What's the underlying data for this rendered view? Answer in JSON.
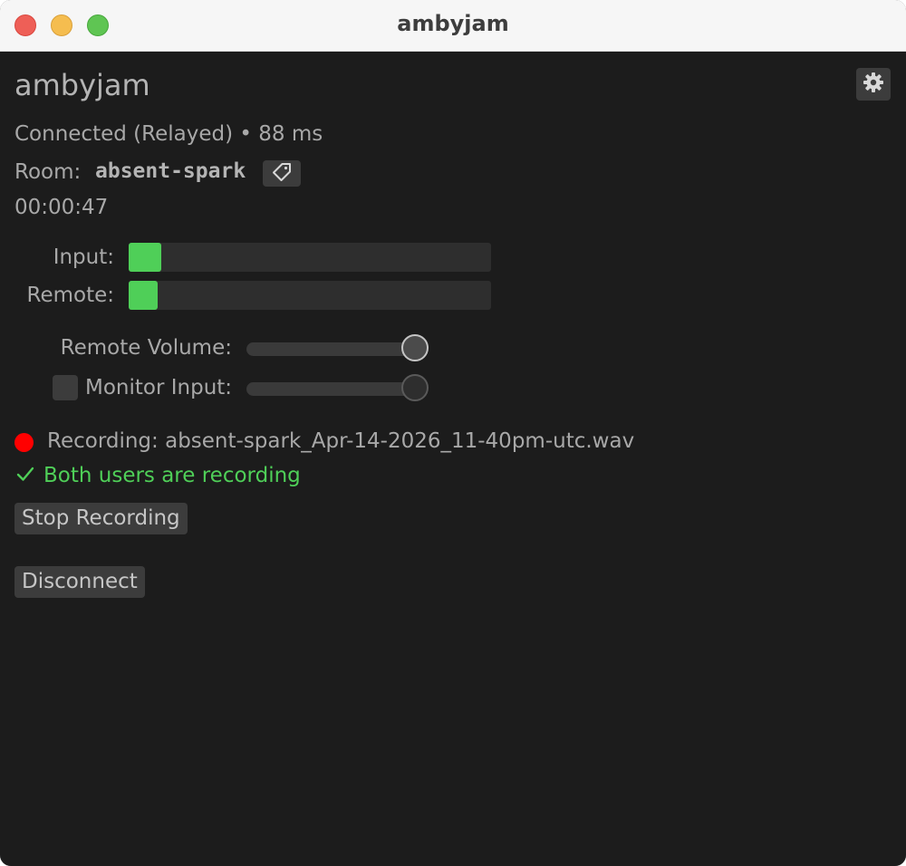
{
  "window": {
    "title": "ambyjam"
  },
  "app": {
    "name": "ambyjam"
  },
  "connection": {
    "status": "Connected (Relayed) • 88 ms"
  },
  "room": {
    "label": "Room:",
    "name": "absent-spark"
  },
  "timer": "00:00:47",
  "meters": [
    {
      "label": "Input:",
      "level": 0.09
    },
    {
      "label": "Remote:",
      "level": 0.08
    }
  ],
  "controls": {
    "remote_volume": {
      "label": "Remote Volume:",
      "value": 1.0
    },
    "monitor_input": {
      "label": "Monitor Input:",
      "checked": false,
      "value": 1.0
    }
  },
  "recording": {
    "text": "Recording: absent-spark_Apr-14-2026_11-40pm-utc.wav",
    "dot_color": "#ff0000",
    "both_status": "Both users are recording",
    "status_color": "#4fcf58"
  },
  "buttons": {
    "stop_recording": "Stop Recording",
    "disconnect": "Disconnect"
  },
  "icons": {
    "settings": "gear-icon",
    "copy_room": "tag-icon",
    "status_check": "check-icon"
  }
}
